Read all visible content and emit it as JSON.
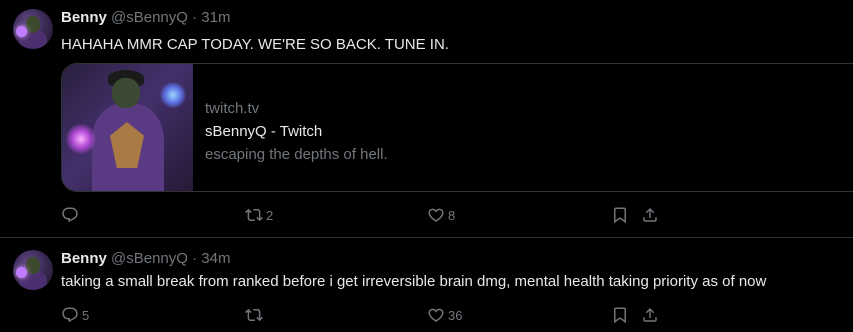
{
  "tweets": [
    {
      "author_name": "Benny",
      "handle_time": "@sBennyQ · 31m",
      "text": "HAHAHA MMR CAP TODAY. WE'RE SO BACK. TUNE IN.",
      "card": {
        "domain": "twitch.tv",
        "title": "sBennyQ - Twitch",
        "description": "escaping the depths of hell."
      },
      "actions": {
        "replies": "",
        "retweets": "2",
        "likes": "8"
      }
    },
    {
      "author_name": "Benny",
      "handle_time": "@sBennyQ · 34m",
      "text": "taking a small break from ranked before i get irreversible brain dmg, mental health taking priority as of now",
      "actions": {
        "replies": "5",
        "retweets": "",
        "likes": "36"
      }
    }
  ],
  "icons": {
    "reply": "reply-icon",
    "retweet": "retweet-icon",
    "like": "heart-icon",
    "bookmark": "bookmark-icon",
    "share": "share-icon"
  },
  "colors": {
    "background": "#000000",
    "text": "#e7e9ea",
    "muted": "#71767b",
    "border": "#2f3336"
  }
}
